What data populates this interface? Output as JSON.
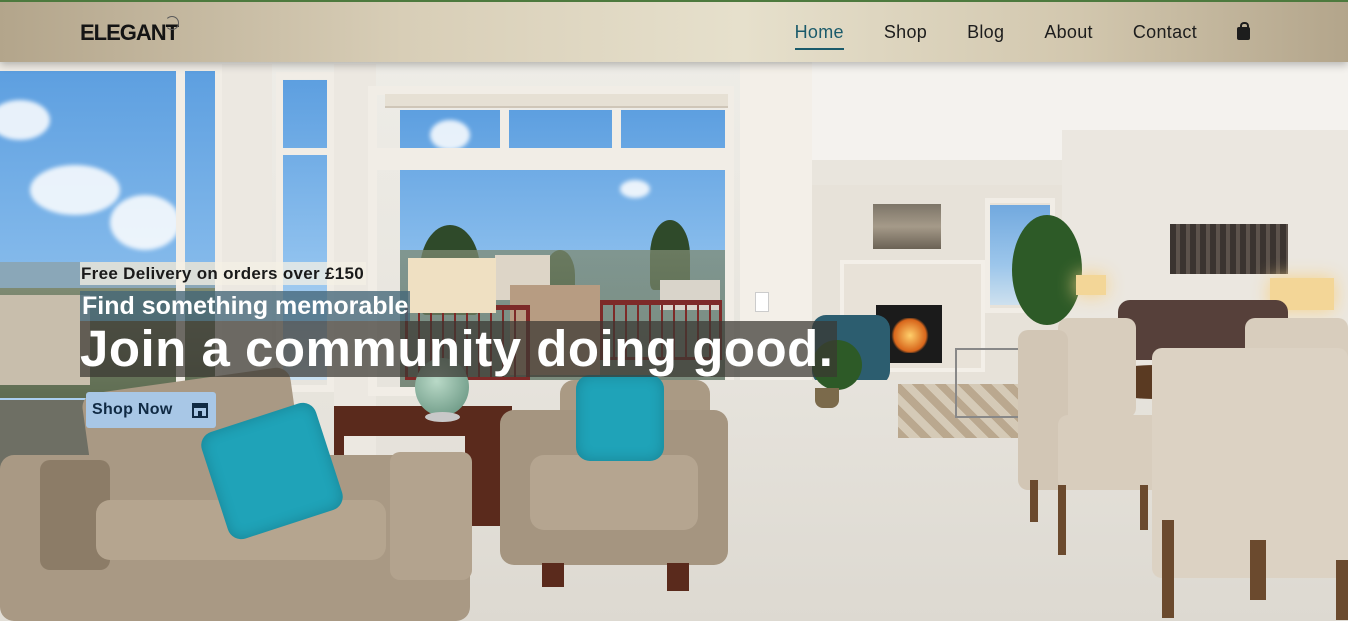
{
  "brand": {
    "logo_text": "ELEGANT"
  },
  "nav": {
    "items": [
      {
        "label": "Home",
        "active": true
      },
      {
        "label": "Shop",
        "active": false
      },
      {
        "label": "Blog",
        "active": false
      },
      {
        "label": "About",
        "active": false
      },
      {
        "label": "Contact",
        "active": false
      }
    ],
    "cart_icon": "shopping-bag-icon"
  },
  "hero": {
    "promo": "Free Delivery on orders over £150",
    "tagline": "Find something memorable",
    "headline": "Join a community doing good.",
    "cta_label": "Shop Now",
    "cta_icon": "store-icon",
    "background": "living-room-photo"
  },
  "colors": {
    "accent": "#1b5b6b",
    "cta_bg": "#a8c7e6",
    "cta_text": "#102a44"
  }
}
